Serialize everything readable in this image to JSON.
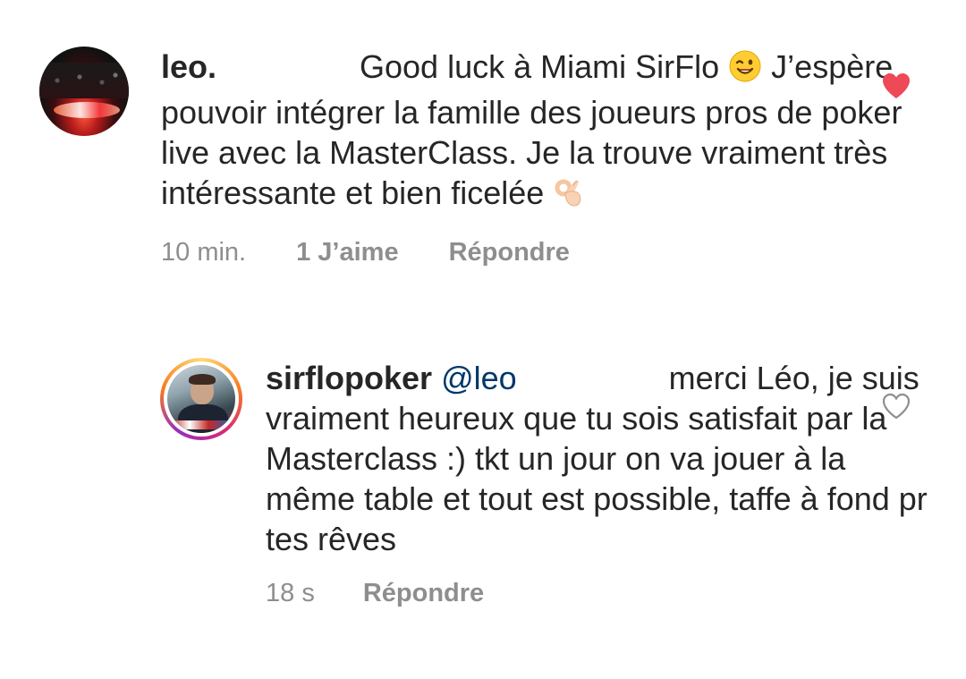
{
  "comment": {
    "username": "leo.",
    "text_first": "Good luck à Miami SirFlo",
    "text_rest": "J’espère pouvoir intégrer la famille des joueurs pros de poker live avec la MasterClass. Je la trouve vraiment très intéressante et bien ficelée",
    "time": "10 min.",
    "likes": "1 J’aime",
    "reply_label": "Répondre",
    "liked": true,
    "like_color": "#ed4956",
    "emojis": [
      "winking-face",
      "ok-hand"
    ]
  },
  "reply": {
    "username": "sirflopoker",
    "mention": "@leo",
    "text_first": "merci Léo,",
    "text_rest": "je suis vraiment heureux que tu sois satisfait par la Masterclass :) tkt un jour on va jouer à la même table et tout est possible, taffe à fond pr tes rêves",
    "time": "18 s",
    "reply_label": "Répondre",
    "liked": false,
    "story_ring": true
  }
}
